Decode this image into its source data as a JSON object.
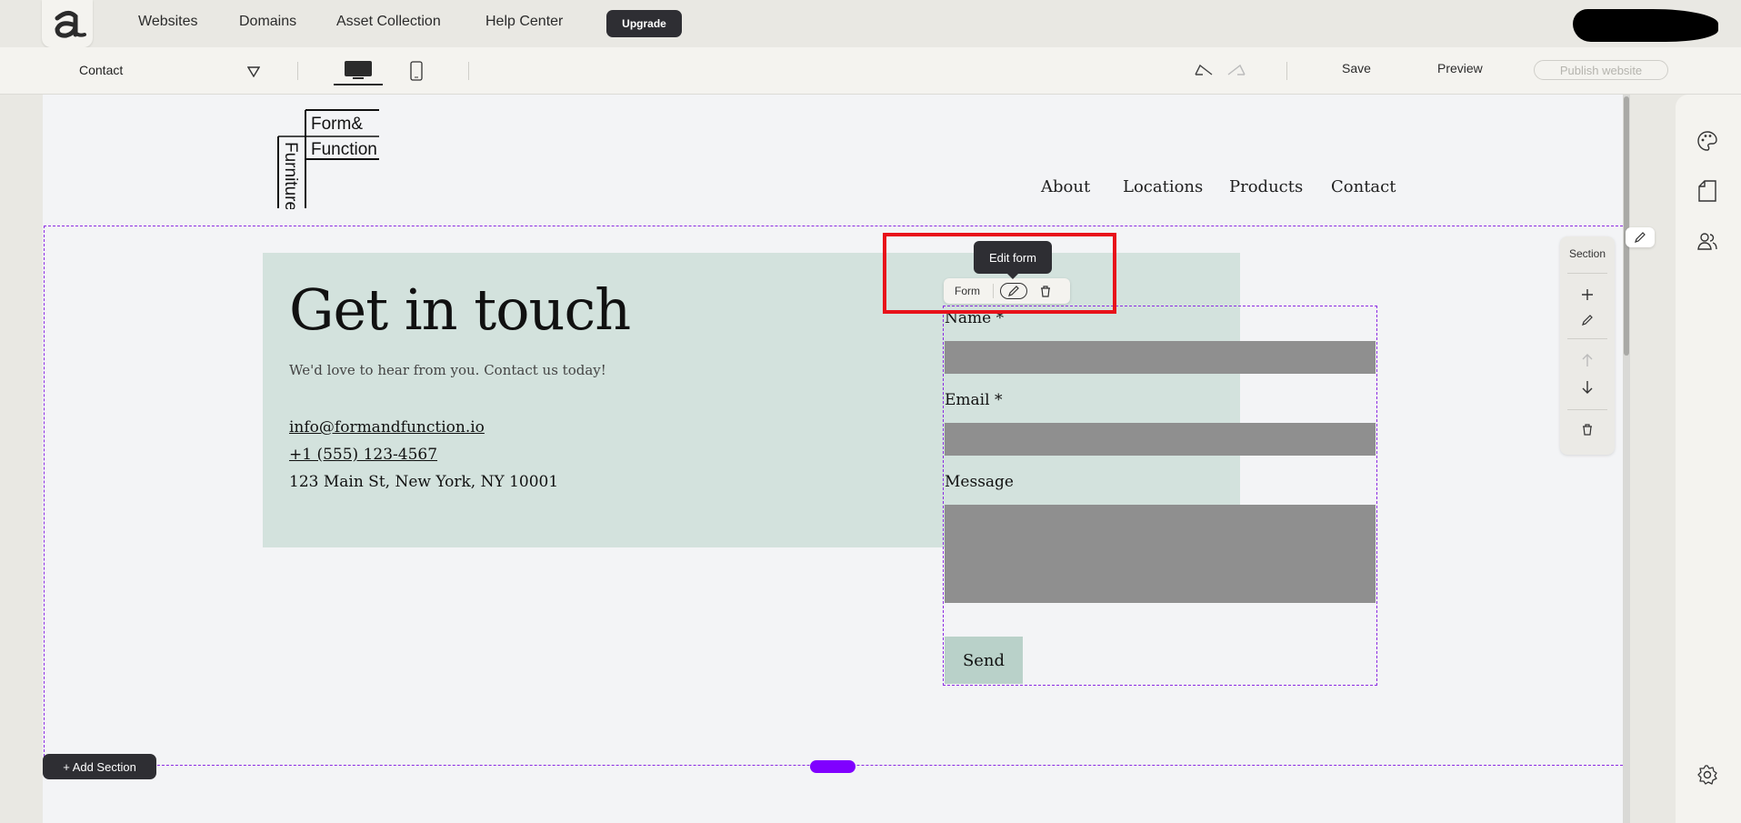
{
  "topnav": {
    "links": [
      "Websites",
      "Domains",
      "Asset Collection",
      "Help Center"
    ],
    "upgrade_label": "Upgrade"
  },
  "toolbar": {
    "page_name": "Contact",
    "save_label": "Save",
    "preview_label": "Preview",
    "publish_label": "Publish website"
  },
  "site": {
    "logo_text": [
      "Form&",
      "Function",
      "Furniture"
    ],
    "nav": [
      "About",
      "Locations",
      "Products",
      "Contact"
    ],
    "heading": "Get in touch",
    "subtext": "We'd love to hear from you. Contact us today!",
    "email": "info@formandfunction.io",
    "phone": "+1 (555) 123-4567",
    "address": "123 Main St, New York, NY 10001"
  },
  "form": {
    "toolbar_label": "Form",
    "tooltip": "Edit form",
    "fields": [
      "Name *",
      "Email *",
      "Message"
    ],
    "send_label": "Send"
  },
  "section_panel": {
    "title": "Section"
  },
  "add_section_label": "+ Add Section",
  "colors": {
    "accent": "#8a2be2",
    "highlight": "#e8121a",
    "card": "#d3e2dd",
    "dark_button": "#2e2e33"
  }
}
